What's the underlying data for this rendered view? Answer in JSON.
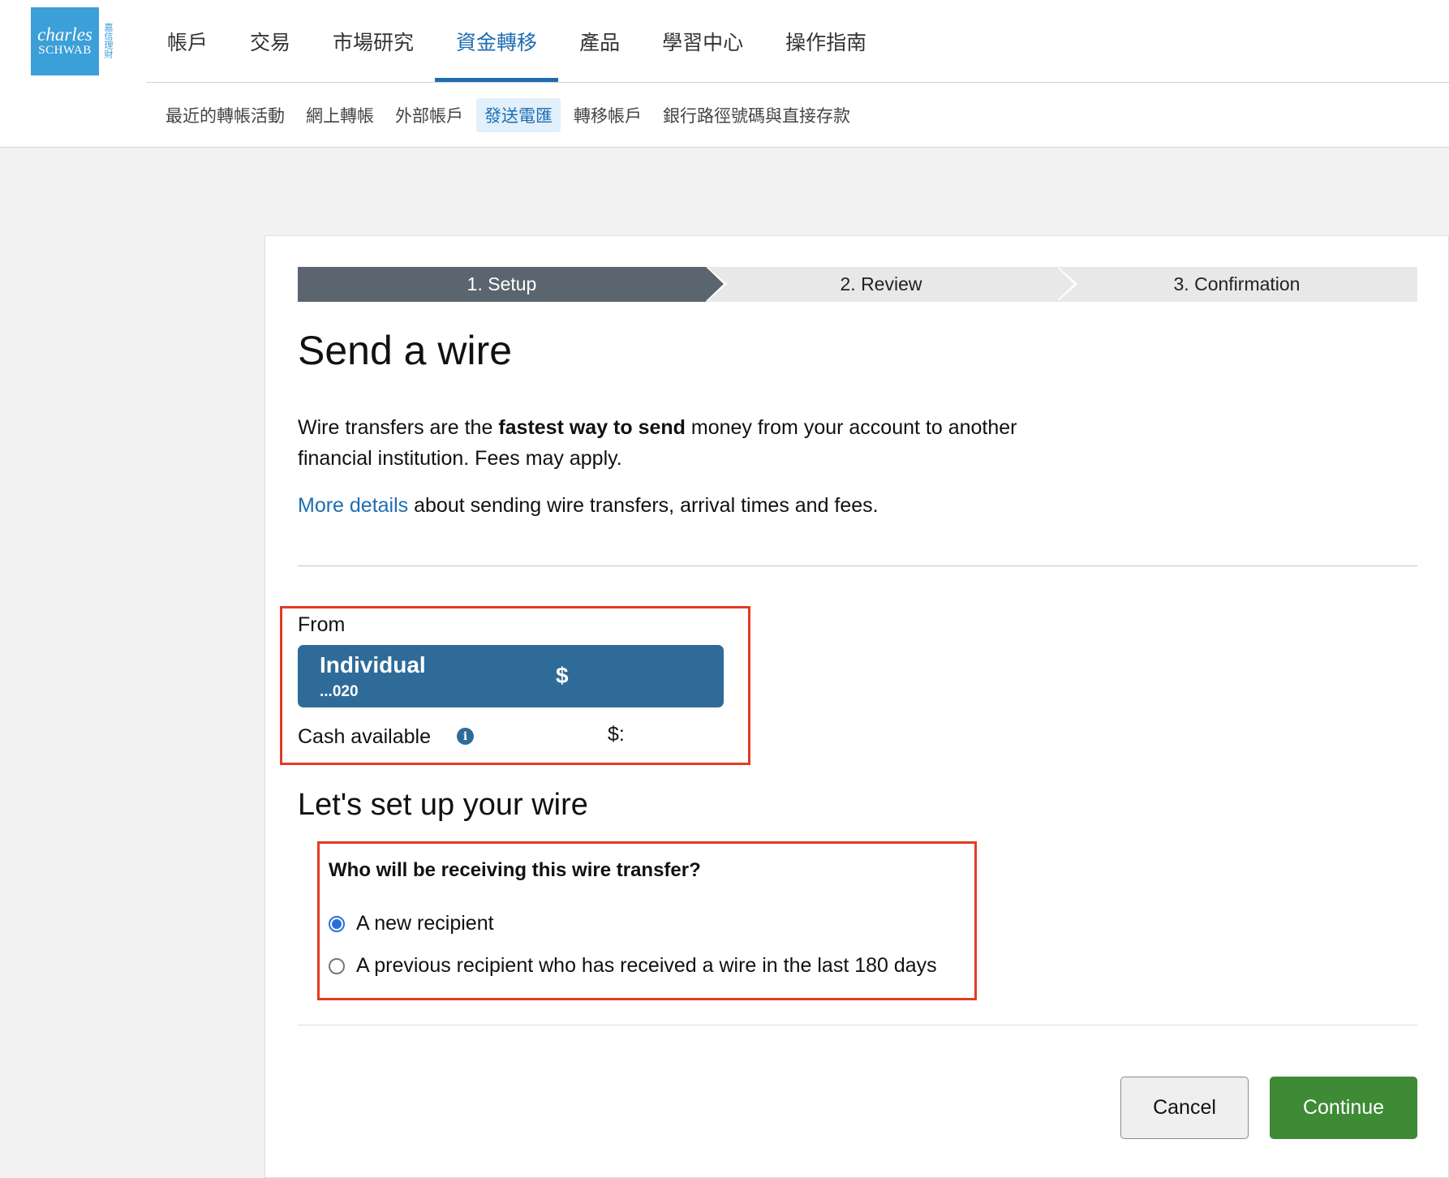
{
  "brand": {
    "logo_line1": "charles",
    "logo_line2": "SCHWAB",
    "logo_cn": "嘉信理財",
    "color": "#3b9fd8"
  },
  "main_nav": {
    "items": [
      {
        "label": "帳戶"
      },
      {
        "label": "交易"
      },
      {
        "label": "市場研究"
      },
      {
        "label": "資金轉移",
        "active": true
      },
      {
        "label": "產品"
      },
      {
        "label": "學習中心"
      },
      {
        "label": "操作指南"
      }
    ]
  },
  "sub_nav": {
    "items": [
      {
        "label": "最近的轉帳活動"
      },
      {
        "label": "網上轉帳"
      },
      {
        "label": "外部帳戶"
      },
      {
        "label": "發送電匯",
        "active": true
      },
      {
        "label": "轉移帳戶"
      },
      {
        "label": "銀行路徑號碼與直接存款"
      }
    ]
  },
  "stepper": {
    "steps": [
      {
        "label": "1. Setup",
        "active": true
      },
      {
        "label": "2. Review"
      },
      {
        "label": "3. Confirmation"
      }
    ]
  },
  "page": {
    "title": "Send a wire",
    "intro_part1": "Wire transfers are the ",
    "intro_bold": "fastest way to send",
    "intro_part2": " money from your account to another financial institution. Fees may apply.",
    "details_link": "More details",
    "details_text": " about sending wire transfers, arrival times and fees."
  },
  "from": {
    "label": "From",
    "account_name": "Individual",
    "account_number": "...020",
    "account_balance_symbol": "$",
    "cash_available_label": "Cash available",
    "info_icon": "info-icon",
    "cash_available_value": "$:"
  },
  "setup": {
    "subtitle": "Let's set up your wire",
    "question": "Who will be receiving this wire transfer?",
    "options": [
      {
        "label": "A new recipient",
        "selected": true
      },
      {
        "label": "A previous recipient who has received a wire in the last 180 days",
        "selected": false
      }
    ]
  },
  "actions": {
    "cancel_label": "Cancel",
    "continue_label": "Continue"
  },
  "colors": {
    "accent_blue": "#1f6db0",
    "account_card": "#2e6b99",
    "continue_green": "#3f8a35",
    "highlight_red": "#e23b24",
    "stepper_active": "#5a6570"
  }
}
